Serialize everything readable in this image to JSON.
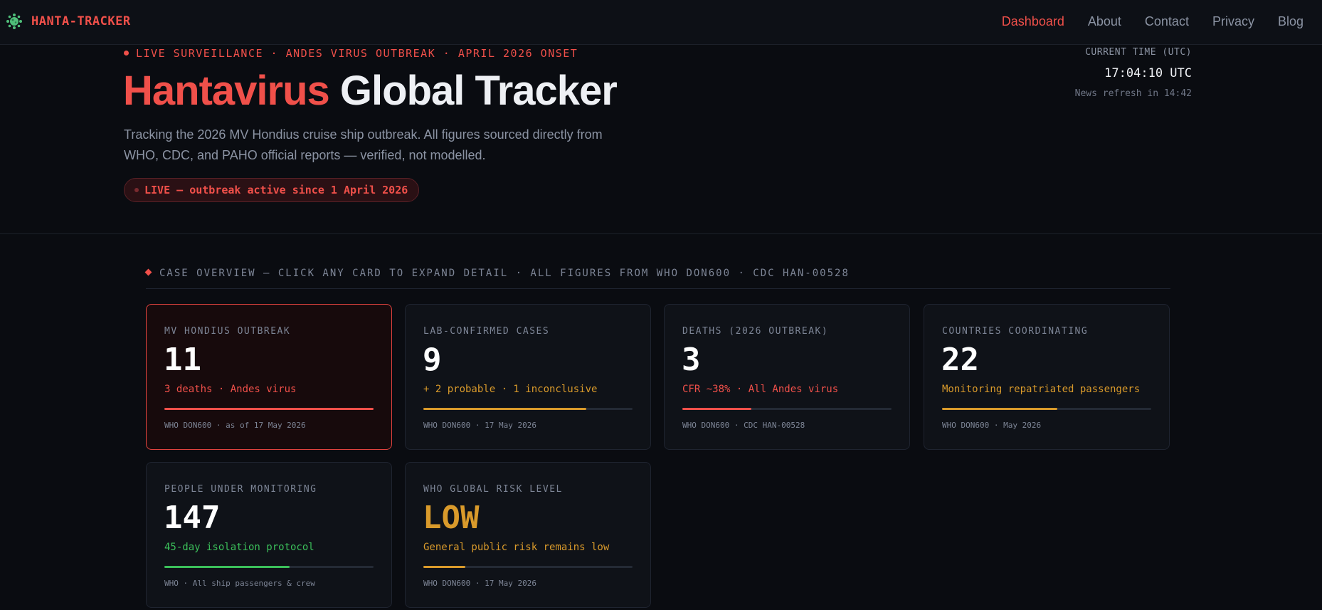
{
  "brand": {
    "name": "HANTA-TRACKER",
    "icon": "virus-icon",
    "color": "#f0504a"
  },
  "nav": {
    "links": [
      {
        "label": "Dashboard",
        "active": true
      },
      {
        "label": "About",
        "active": false
      },
      {
        "label": "Contact",
        "active": false
      },
      {
        "label": "Privacy",
        "active": false
      },
      {
        "label": "Blog",
        "active": false
      }
    ]
  },
  "hero": {
    "eyebrow": "LIVE SURVEILLANCE · ANDES VIRUS OUTBREAK · APRIL 2026 ONSET",
    "title_accent": "Hantavirus",
    "title_rest": "Global Tracker",
    "description": "Tracking the 2026 MV Hondius cruise ship outbreak. All figures sourced directly from WHO, CDC, and PAHO official reports — verified, not modelled.",
    "live_badge": "LIVE — outbreak active since 1 April 2026"
  },
  "clock": {
    "label": "CURRENT TIME (UTC)",
    "time": "17:04:10 UTC",
    "refresh": "News refresh in 14:42"
  },
  "overview": {
    "heading": "CASE OVERVIEW — CLICK ANY CARD TO EXPAND DETAIL · ALL FIGURES FROM WHO DON600 · CDC HAN-00528"
  },
  "cards": [
    {
      "label": "MV HONDIUS OUTBREAK",
      "value": "11",
      "sub": "3 deaths · Andes virus",
      "sub_color": "#f0504a",
      "progress": 1.0,
      "bar_color": "#f0504a",
      "source": "WHO DON600 · as of 17 May 2026"
    },
    {
      "label": "LAB-CONFIRMED CASES",
      "value": "9",
      "sub": "+ 2 probable · 1 inconclusive",
      "sub_color": "#d99a2b",
      "progress": 0.78,
      "bar_color": "#d99a2b",
      "source": "WHO DON600 · 17 May 2026"
    },
    {
      "label": "DEATHS (2026 OUTBREAK)",
      "value": "3",
      "sub": "CFR ~38% · All Andes virus",
      "sub_color": "#f0504a",
      "progress": 0.33,
      "bar_color": "#f0504a",
      "source": "WHO DON600 · CDC HAN-00528"
    },
    {
      "label": "COUNTRIES COORDINATING",
      "value": "22",
      "sub": "Monitoring repatriated passengers",
      "sub_color": "#d99a2b",
      "progress": 0.55,
      "bar_color": "#d99a2b",
      "source": "WHO DON600 · May 2026"
    },
    {
      "label": "PEOPLE UNDER MONITORING",
      "value": "147",
      "sub": "45-day isolation protocol",
      "sub_color": "#3bbf5a",
      "progress": 0.6,
      "bar_color": "#3bbf5a",
      "source": "WHO · All ship passengers & crew"
    },
    {
      "label": "WHO GLOBAL RISK LEVEL",
      "value": "LOW",
      "sub": "General public risk remains low",
      "sub_color": "#d99a2b",
      "progress": 0.2,
      "bar_color": "#d99a2b",
      "source": "WHO DON600 · 17 May 2026"
    }
  ]
}
